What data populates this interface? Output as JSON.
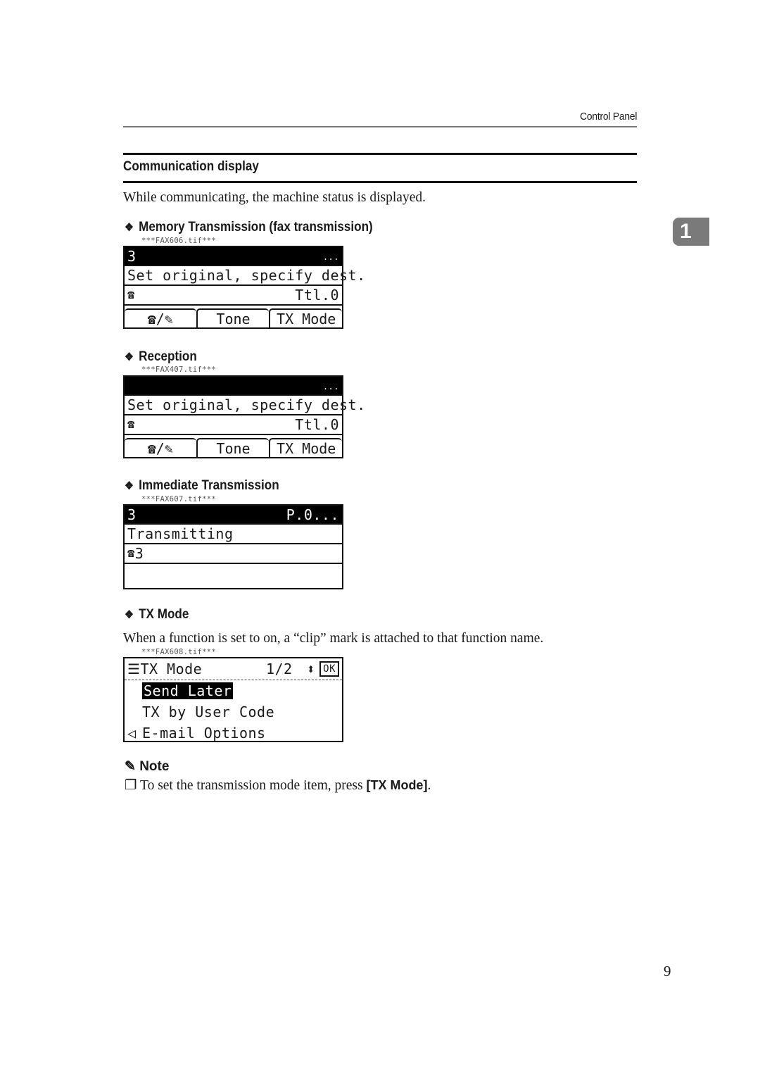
{
  "running_head": "Control Panel",
  "section": {
    "title": "Communication display",
    "intro": "While communicating, the machine status is displayed."
  },
  "chapter_tab": "1",
  "subsections": [
    {
      "title": "Memory Transmission (fax transmission)",
      "figure_file": "***FAX606.tif***",
      "lcd": {
        "status_left": "3",
        "status_right": "...",
        "message": "Set original, specify dest.",
        "line3_icon": "phone-icon",
        "line3_right": "Ttl.0",
        "buttons": [
          "☎/✎",
          "Tone",
          "TX Mode"
        ]
      }
    },
    {
      "title": "Reception",
      "figure_file": "***FAX407.tif***",
      "lcd": {
        "status_left": "",
        "status_right": "...",
        "message": "Set original, specify dest.",
        "line3_icon": "phone-icon",
        "line3_right": "Ttl.0",
        "buttons": [
          "☎/✎",
          "Tone",
          "TX Mode"
        ]
      }
    },
    {
      "title": "Immediate Transmission",
      "figure_file": "***FAX607.tif***",
      "lcd": {
        "status_left": "3",
        "status_right": "P.0...",
        "message": "Transmitting",
        "line3_icon": "phone-icon",
        "line3_text": "3"
      }
    },
    {
      "title": "TX Mode",
      "body": "When a function is set to on, a “clip” mark is attached to that function name.",
      "figure_file": "***FAX608.tif***",
      "menu": {
        "title": "TX Mode",
        "page": "1/2",
        "ok": "OK",
        "items": [
          "Send Later",
          "TX by User Code",
          "E-mail Options"
        ],
        "selected_index": 0
      }
    }
  ],
  "note": {
    "heading": "Note",
    "text_before": "To set the transmission mode item, press ",
    "key": "[TX Mode]",
    "text_after": "."
  },
  "page_number": "9"
}
